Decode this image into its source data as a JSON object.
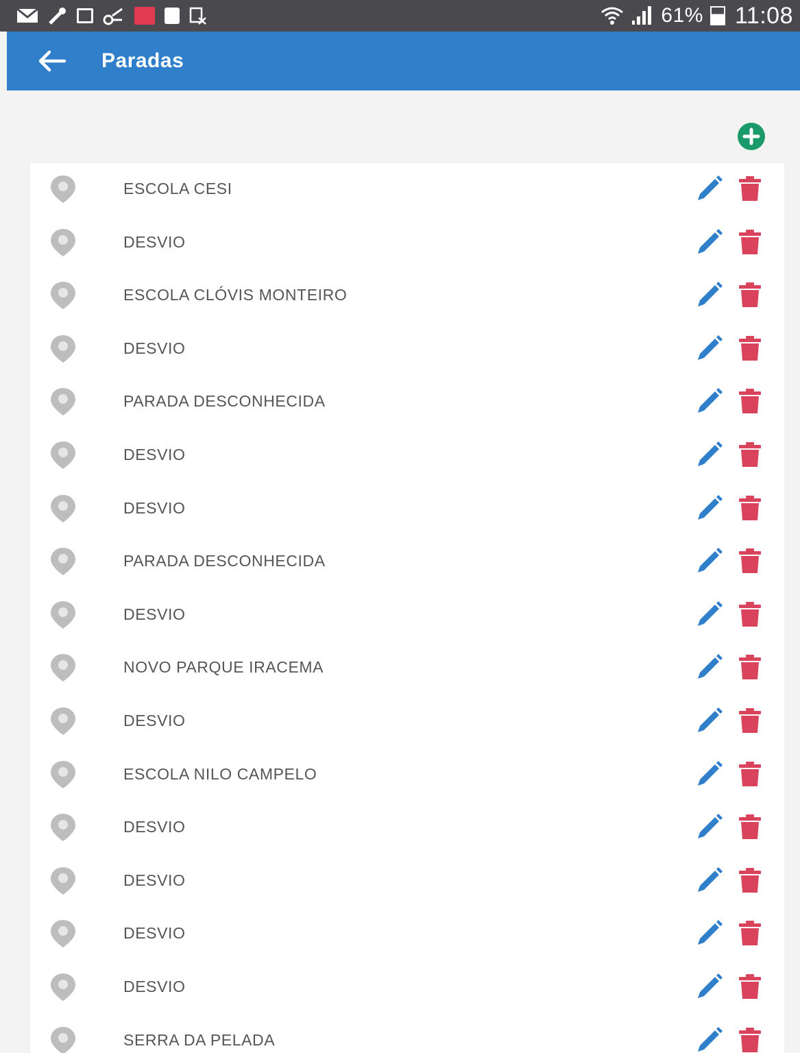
{
  "status_bar": {
    "battery_percent": "61%",
    "time": "11:08"
  },
  "app_bar": {
    "title": "Paradas",
    "back_icon": "arrow-left-icon"
  },
  "actions": {
    "add_icon": "plus-circle-icon"
  },
  "colors": {
    "app_bar": "#2f7fcb",
    "status_bar": "#4a4a4e",
    "add": "#1a9a6a",
    "edit": "#2f7fcb",
    "delete": "#d9435c",
    "pin": "#bdbdbd"
  },
  "stops": [
    {
      "name": "ESCOLA CESI"
    },
    {
      "name": "DESVIO"
    },
    {
      "name": "ESCOLA CLÓVIS MONTEIRO"
    },
    {
      "name": "DESVIO"
    },
    {
      "name": "PARADA DESCONHECIDA"
    },
    {
      "name": "DESVIO"
    },
    {
      "name": "DESVIO"
    },
    {
      "name": "PARADA DESCONHECIDA"
    },
    {
      "name": "DESVIO"
    },
    {
      "name": "NOVO PARQUE IRACEMA"
    },
    {
      "name": "DESVIO"
    },
    {
      "name": "ESCOLA NILO CAMPELO"
    },
    {
      "name": "DESVIO"
    },
    {
      "name": "DESVIO"
    },
    {
      "name": "DESVIO"
    },
    {
      "name": "DESVIO"
    },
    {
      "name": "SERRA DA PELADA"
    }
  ]
}
